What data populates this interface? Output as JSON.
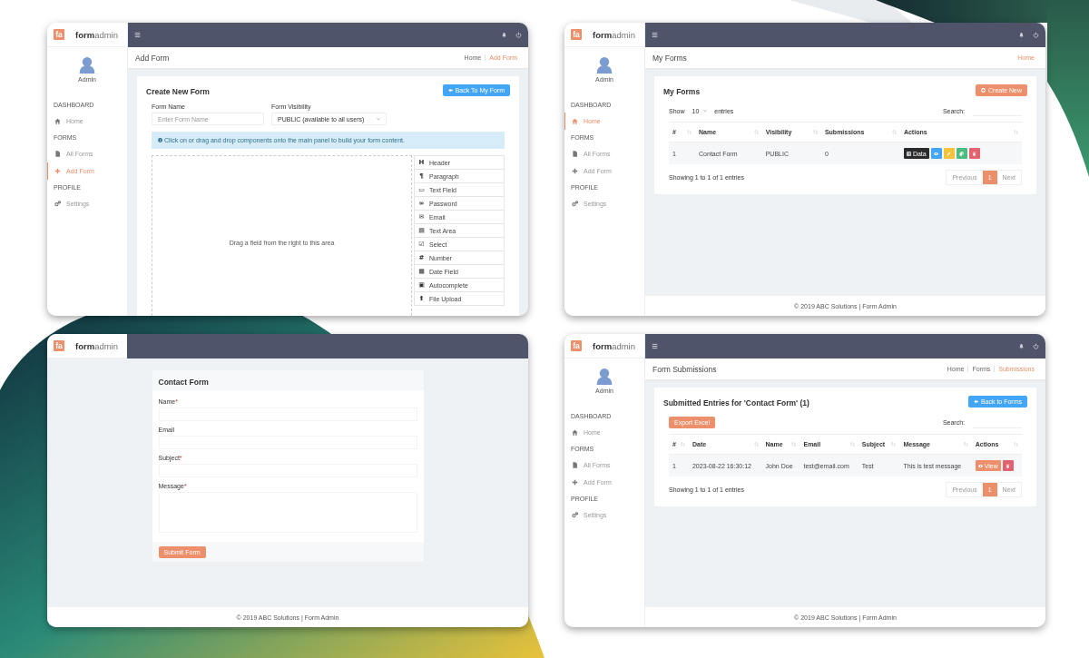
{
  "windows": [
    {
      "kind": "builder",
      "brand": {
        "mark": "fa",
        "name": "**form**admin"
      },
      "user": "Admin",
      "nav": [
        {
          "heading": "DASHBOARD",
          "items": [
            {
              "label": "Home",
              "selected": false
            }
          ]
        },
        {
          "heading": "FORMS",
          "items": [
            {
              "label": "All Forms",
              "selected": false
            },
            {
              "label": "Add Form",
              "selected": true
            }
          ]
        },
        {
          "heading": "PROFILE",
          "items": [
            {
              "label": "Settings",
              "selected": false
            }
          ]
        }
      ],
      "page_title": "Add Form",
      "breadcrumbs": [
        {
          "label": "Home",
          "selected": false
        },
        {
          "label": "Add Form",
          "selected": true
        }
      ],
      "card": {
        "title": "Create New Form",
        "button": {
          "kind": "back",
          "label": "Back To My Form"
        },
        "fields": [
          {
            "kind": "input",
            "label": "Form Name",
            "placeholder": "Enter Form Name"
          },
          {
            "kind": "select",
            "label": "Form Visibility",
            "value": "PUBLIC (available to all users)"
          }
        ],
        "alert": "Click on or drag and drop components onto the main panel to build your form content.",
        "dropzone": "Drag a field from the right to this area",
        "components": [
          {
            "icon": "H",
            "label": "Header"
          },
          {
            "icon": "¶",
            "label": "Paragraph"
          },
          {
            "icon": "▭",
            "label": "Text Field"
          },
          {
            "icon": "∞",
            "label": "Password"
          },
          {
            "icon": "✉",
            "label": "Email"
          },
          {
            "icon": "▤",
            "label": "Text Area"
          },
          {
            "icon": "☑",
            "label": "Select"
          },
          {
            "icon": "#",
            "label": "Number"
          },
          {
            "icon": "▦",
            "label": "Date Field"
          },
          {
            "icon": "▣",
            "label": "Autocomplete"
          },
          {
            "icon": "⬆",
            "label": "File Upload"
          }
        ]
      }
    },
    {
      "kind": "list",
      "brand": {
        "mark": "fa",
        "name": "**form**admin"
      },
      "user": "Admin",
      "nav": [
        {
          "heading": "DASHBOARD",
          "items": [
            {
              "label": "Home",
              "selected": true
            }
          ]
        },
        {
          "heading": "FORMS",
          "items": [
            {
              "label": "All Forms",
              "selected": false
            },
            {
              "label": "Add Form",
              "selected": false
            }
          ]
        },
        {
          "heading": "PROFILE",
          "items": [
            {
              "label": "Settings",
              "selected": false
            }
          ]
        }
      ],
      "page_title": "My Forms",
      "breadcrumbs": [
        {
          "label": "Home",
          "selected": true
        }
      ],
      "card": {
        "title": "My Forms",
        "button": {
          "kind": "create",
          "label": "Create New"
        },
        "length": {
          "before": "Show",
          "value": "10",
          "after": "entries"
        },
        "search": "Search:",
        "columns": [
          "#",
          "Name",
          "Visibility",
          "Submissions",
          "Actions"
        ],
        "rows": [
          {
            "cells": [
              "1",
              "Contact Form",
              "PUBLIC",
              "0"
            ],
            "actions": [
              {
                "kind": "data",
                "label": "Data",
                "color": "#2b2b2b"
              },
              {
                "kind": "view",
                "color": "#42a5f5"
              },
              {
                "kind": "edit",
                "color": "#f5c33b"
              },
              {
                "kind": "copy",
                "color": "#4cbb7f"
              },
              {
                "kind": "delete",
                "color": "#e2636f"
              }
            ]
          }
        ],
        "info": "Showing 1 to 1 of 1 entries",
        "pages": [
          {
            "label": "Previous",
            "selected": false
          },
          {
            "label": "1",
            "selected": true
          },
          {
            "label": "Next",
            "selected": false
          }
        ]
      },
      "footer": "© 2019 ABC Solutions | Form Admin"
    },
    {
      "kind": "public",
      "brand": {
        "mark": "fa",
        "name": "**form**admin"
      },
      "card": {
        "title": "Contact Form",
        "fields": [
          {
            "kind": "input",
            "label": "Name",
            "mark": "*"
          },
          {
            "kind": "input",
            "label": "Email"
          },
          {
            "kind": "input",
            "label": "Subject",
            "mark": "*"
          },
          {
            "kind": "textarea",
            "label": "Message",
            "mark": "*"
          }
        ],
        "button": "Submit Form"
      },
      "footer": "© 2019 ABC Solutions | Form Admin"
    },
    {
      "kind": "list",
      "brand": {
        "mark": "fa",
        "name": "**form**admin"
      },
      "user": "Admin",
      "nav": [
        {
          "heading": "DASHBOARD",
          "items": [
            {
              "label": "Home",
              "selected": false
            }
          ]
        },
        {
          "heading": "FORMS",
          "items": [
            {
              "label": "All Forms",
              "selected": false
            },
            {
              "label": "Add Form",
              "selected": false
            }
          ]
        },
        {
          "heading": "PROFILE",
          "items": [
            {
              "label": "Settings",
              "selected": false
            }
          ]
        }
      ],
      "page_title": "Form Submissions",
      "breadcrumbs": [
        {
          "label": "Home",
          "selected": false
        },
        {
          "label": "Forms",
          "selected": false
        },
        {
          "label": "Submissions",
          "selected": true
        }
      ],
      "card": {
        "title": "Submitted Entries for 'Contact Form' (1)",
        "button": {
          "kind": "back",
          "label": "Back to Forms"
        },
        "export": "Export Excel",
        "search": "Search:",
        "columns": [
          "#",
          "Date",
          "Name",
          "Email",
          "Subject",
          "Message",
          "Actions"
        ],
        "rows": [
          {
            "cells": [
              "1",
              "2023-08-22 16:30:12",
              "John Doe",
              "test@email.com",
              "Test",
              "This is test message"
            ],
            "actions": [
              {
                "kind": "view",
                "label": "View",
                "color": "#ec8f6a"
              },
              {
                "kind": "delete",
                "color": "#e2636f"
              }
            ]
          }
        ],
        "info": "Showing 1 to 1 of 1 entries",
        "pages": [
          {
            "label": "Previous",
            "selected": false
          },
          {
            "label": "1",
            "selected": true
          },
          {
            "label": "Next",
            "selected": false
          }
        ]
      },
      "footer": "© 2019 ABC Solutions | Form Admin"
    }
  ]
}
